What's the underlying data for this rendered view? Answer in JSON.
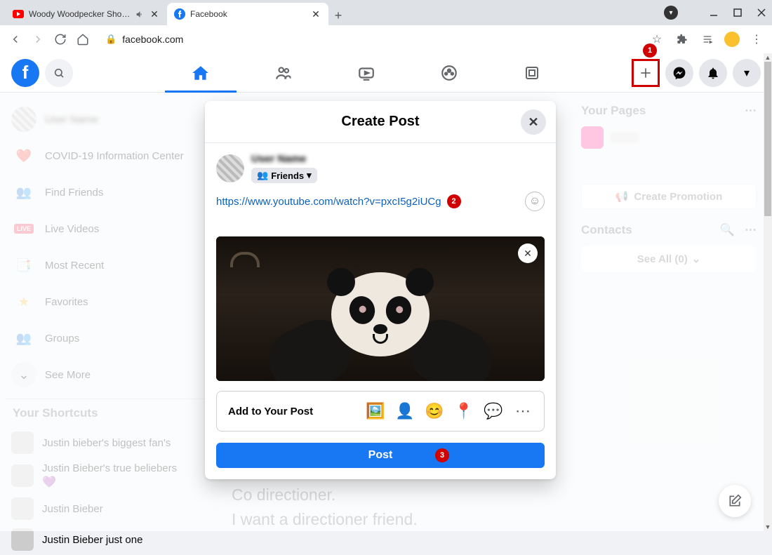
{
  "browser": {
    "tabs": [
      {
        "title": "Woody Woodpecker Show |",
        "icon": "youtube",
        "audio": true
      },
      {
        "title": "Facebook",
        "icon": "facebook",
        "active": true
      }
    ],
    "url": "facebook.com"
  },
  "fbHeader": {
    "tabs": [
      "home",
      "friends",
      "watch",
      "groups",
      "gaming"
    ]
  },
  "sidebar": {
    "user": "User Name",
    "items": [
      {
        "label": "COVID-19 Information Center",
        "color": "#e941a3"
      },
      {
        "label": "Find Friends",
        "color": "#1877f2"
      },
      {
        "label": "Live Videos",
        "color": "#f02849"
      },
      {
        "label": "Most Recent",
        "color": "#1877f2"
      },
      {
        "label": "Favorites",
        "color": "#f7b928"
      },
      {
        "label": "Groups",
        "color": "#1877f2"
      }
    ],
    "seeMore": "See More",
    "shortcutsHeader": "Your Shortcuts",
    "shortcuts": [
      {
        "label": "Justin bieber's biggest fan's"
      },
      {
        "label": "Justin Bieber's true beliebers"
      },
      {
        "label": "Justin Bieber"
      },
      {
        "label": "Justin Bieber just one"
      }
    ]
  },
  "rightCol": {
    "yourPages": "Your Pages",
    "createPromotion": "Create Promotion",
    "contacts": "Contacts",
    "seeAll": "See All (0)"
  },
  "mainText": {
    "line1": "Co directioner.",
    "line2": "I want a directioner friend."
  },
  "modal": {
    "title": "Create Post",
    "authorName": "User Name",
    "audienceLabel": "Friends",
    "linkText": "https://www.youtube.com/watch?v=pxcI5g2iUCg",
    "addTo": "Add to Your Post",
    "postLabel": "Post"
  },
  "annotations": {
    "a1": "1",
    "a2": "2",
    "a3": "3"
  }
}
